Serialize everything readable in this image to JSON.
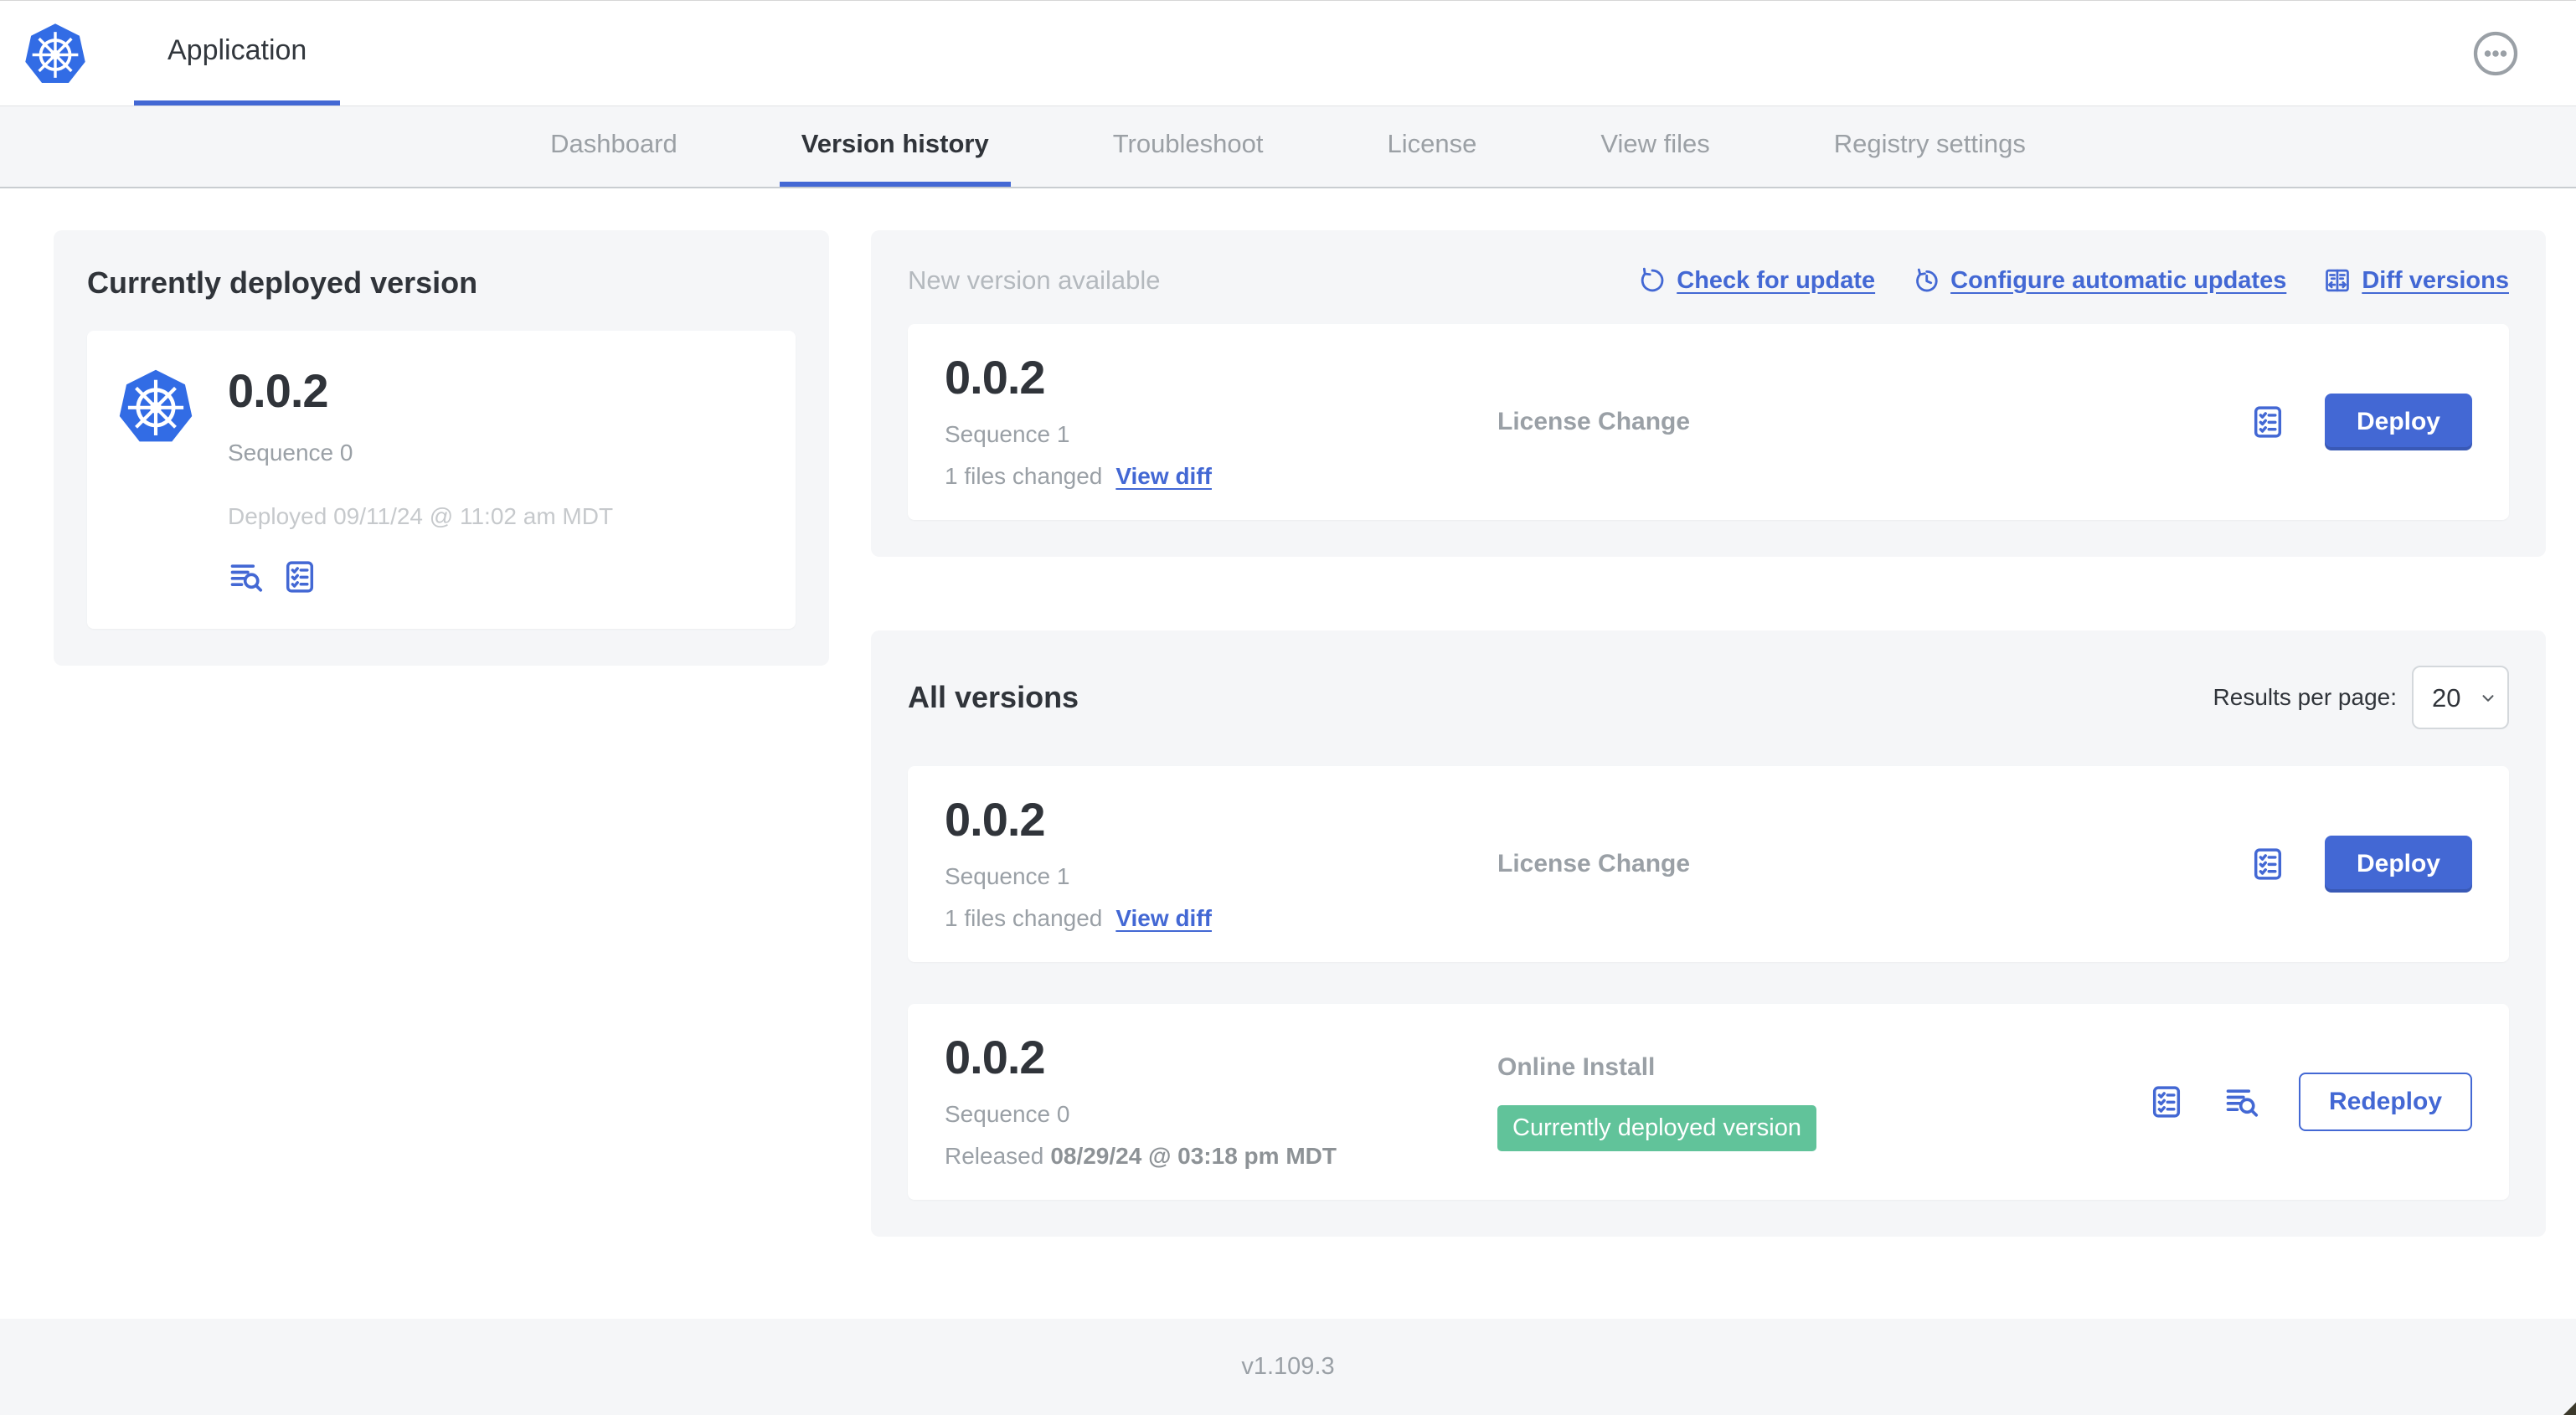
{
  "colors": {
    "accent_blue": "#4368d4",
    "kubernetes_blue": "#326ce5",
    "success_green": "#61c39a",
    "panel_gray": "#f5f6f8",
    "text_dark": "#30343a",
    "text_gray": "#9aa0a6",
    "text_light_gray": "#c6c9cc"
  },
  "header": {
    "app_tab_label": "Application"
  },
  "nav": {
    "tabs": [
      {
        "label": "Dashboard",
        "active": false
      },
      {
        "label": "Version history",
        "active": true
      },
      {
        "label": "Troubleshoot",
        "active": false
      },
      {
        "label": "License",
        "active": false
      },
      {
        "label": "View files",
        "active": false
      },
      {
        "label": "Registry settings",
        "active": false
      }
    ]
  },
  "current_version_card": {
    "title": "Currently deployed version",
    "version": "0.0.2",
    "sequence": "Sequence 0",
    "deployed_timestamp": "Deployed 09/11/24 @ 11:02 am MDT"
  },
  "new_version_panel": {
    "title": "New version available",
    "check_for_update_label": "Check for update",
    "configure_updates_label": "Configure automatic updates",
    "diff_versions_label": "Diff versions",
    "card": {
      "version": "0.0.2",
      "sequence": "Sequence 1",
      "files_changed": "1 files changed",
      "view_diff_label": "View diff",
      "source": "License Change",
      "action_label": "Deploy"
    }
  },
  "all_versions_panel": {
    "title": "All versions",
    "results_per_page_label": "Results per page:",
    "results_per_page_value": "20",
    "rows": [
      {
        "version": "0.0.2",
        "sequence": "Sequence 1",
        "files_changed": "1 files changed",
        "view_diff_label": "View diff",
        "source": "License Change",
        "action_label": "Deploy"
      },
      {
        "version": "0.0.2",
        "sequence": "Sequence 0",
        "released_prefix": "Released",
        "released_timestamp": "08/29/24 @ 03:18 pm MDT",
        "source": "Online Install",
        "status_badge": "Currently deployed version",
        "action_label": "Redeploy"
      }
    ]
  },
  "page_footer": {
    "version_label": "v1.109.3"
  }
}
